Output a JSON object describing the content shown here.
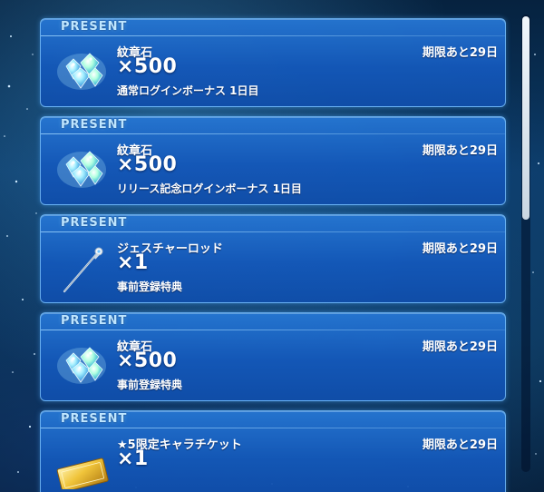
{
  "present_list": {
    "items": [
      {
        "tag": "PRESENT",
        "item_name": "紋章石",
        "quantity": "×500",
        "description": "通常ログインボーナス 1日目",
        "deadline": "期限あと29日",
        "icon": "crest-stones-icon"
      },
      {
        "tag": "PRESENT",
        "item_name": "紋章石",
        "quantity": "×500",
        "description": "リリース記念ログインボーナス 1日目",
        "deadline": "期限あと29日",
        "icon": "crest-stones-icon"
      },
      {
        "tag": "PRESENT",
        "item_name": "ジェスチャーロッド",
        "quantity": "×1",
        "description": "事前登録特典",
        "deadline": "期限あと29日",
        "icon": "gesture-rod-icon"
      },
      {
        "tag": "PRESENT",
        "item_name": "紋章石",
        "quantity": "×500",
        "description": "事前登録特典",
        "deadline": "期限あと29日",
        "icon": "crest-stones-icon"
      },
      {
        "tag": "PRESENT",
        "item_name": "★5限定キャラチケット",
        "quantity": "×1",
        "description": "",
        "deadline": "期限あと29日",
        "icon": "character-ticket-icon"
      }
    ]
  },
  "colors": {
    "card_fill": "#1a5cb8",
    "card_border": "#82c8ff",
    "tag_text": "#bfe6ff",
    "scroll_thumb": "#e6eef5"
  }
}
